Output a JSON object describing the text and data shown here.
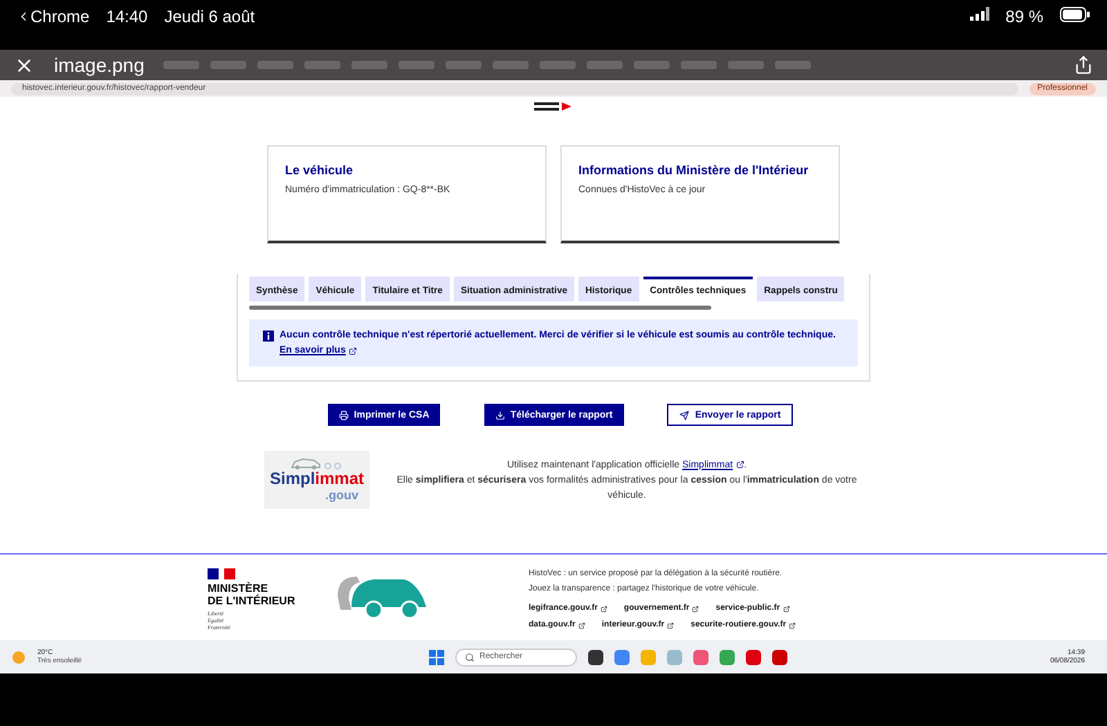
{
  "status_bar": {
    "back_app": "Chrome",
    "time": "14:40",
    "date": "Jeudi 6 août",
    "battery": "89 %"
  },
  "viewer": {
    "title": "image.png"
  },
  "browser": {
    "url": "histovec.interieur.gouv.fr/histovec/rapport-vendeur",
    "profile": "Professionnel"
  },
  "cards": [
    {
      "title": "Le véhicule",
      "text": "Numéro d'immatriculation : GQ-8**-BK"
    },
    {
      "title": "Informations du Ministère de l'Intérieur",
      "text": "Connues d'HistoVec à ce jour"
    }
  ],
  "tabs": [
    {
      "label": "Synthèse",
      "selected": false
    },
    {
      "label": "Véhicule",
      "selected": false
    },
    {
      "label": "Titulaire et Titre",
      "selected": false
    },
    {
      "label": "Situation administrative",
      "selected": false
    },
    {
      "label": "Historique",
      "selected": false
    },
    {
      "label": "Contrôles techniques",
      "selected": true
    },
    {
      "label": "Rappels constru",
      "selected": false
    }
  ],
  "notice": {
    "text": "Aucun contrôle technique n'est répertorié actuellement. Merci de vérifier si le véhicule est soumis au contrôle technique.",
    "link": "En savoir plus"
  },
  "actions": [
    {
      "label": "Imprimer le CSA",
      "kind": "primary"
    },
    {
      "label": "Télécharger le rapport",
      "kind": "primary"
    },
    {
      "label": "Envoyer le rapport",
      "kind": "secondary"
    }
  ],
  "promo": {
    "logo_main": "Simpl",
    "logo_accent": "immat",
    "logo_suffix": ".gouv",
    "line1": "Utilisez maintenant l'application officielle",
    "link": "Simplimmat",
    "line1_end": ".",
    "line2": "Elle **simplifiera** et **sécurisera** vos formalités administratives pour la **cession** ou l'**immatriculation** de votre véhicule."
  },
  "footer": {
    "ministry": [
      "MINISTÈRE",
      "DE L'INTÉRIEUR"
    ],
    "motto": [
      "Liberté",
      "Égalité",
      "Fraternité"
    ],
    "lines": [
      "HistoVec : un service proposé par la délégation à la sécurité routière.",
      "Jouez la transparence : partagez l'historique de votre véhicule."
    ],
    "links": [
      "legifrance.gouv.fr",
      "gouvernement.fr",
      "service-public.fr",
      "data.gouv.fr",
      "interieur.gouv.fr",
      "securite-routiere.gouv.fr"
    ]
  },
  "taskbar": {
    "temperature": "20°C",
    "weather": "Très ensoleillé",
    "search_placeholder": "Rechercher",
    "time": "14:39",
    "date": "06/08/2026"
  }
}
